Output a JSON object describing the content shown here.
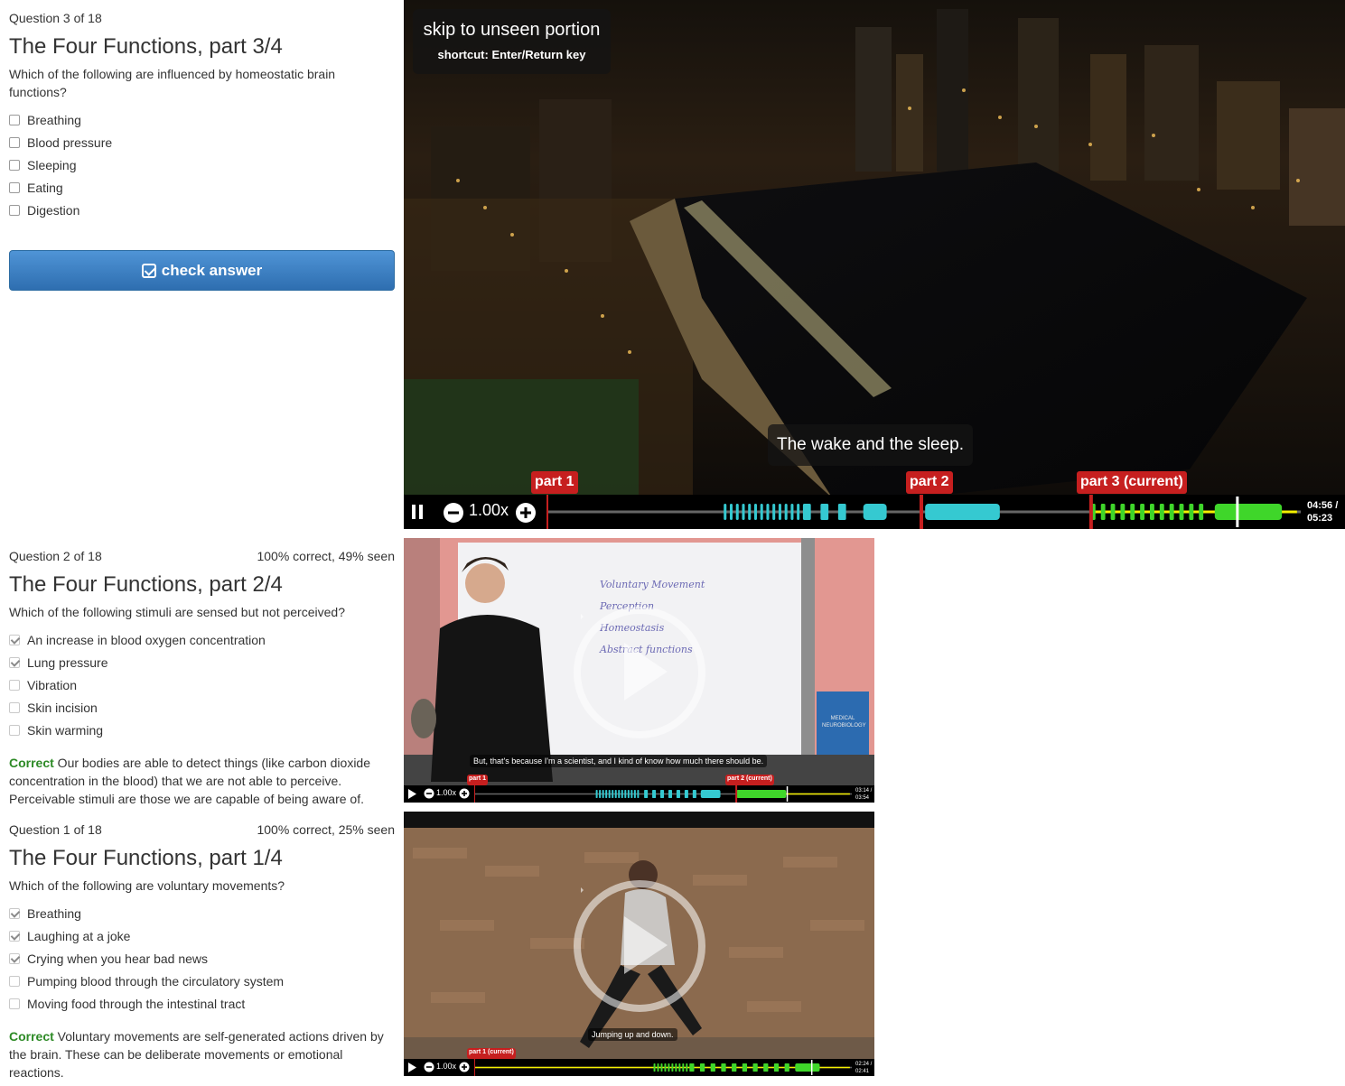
{
  "q3": {
    "meta": "Question 3 of 18",
    "title": "The Four Functions, part 3/4",
    "prompt": "Which of the following are influenced by homeostatic brain functions?",
    "options": [
      "Breathing",
      "Blood pressure",
      "Sleeping",
      "Eating",
      "Digestion"
    ],
    "checked": [
      false,
      false,
      false,
      false,
      false
    ],
    "button": "check answer"
  },
  "q2": {
    "meta": "Question 2 of 18",
    "score": "100% correct, 49% seen",
    "title": "The Four Functions, part 2/4",
    "prompt": "Which of the following stimuli are sensed but not perceived?",
    "options": [
      "An increase in blood oxygen concentration",
      "Lung pressure",
      "Vibration",
      "Skin incision",
      "Skin warming"
    ],
    "checked": [
      true,
      true,
      false,
      false,
      false
    ],
    "feedback_label": "Correct",
    "feedback_text": " Our bodies are able to detect things (like carbon dioxide concentration in the blood) that we are not able to perceive. Perceivable stimuli are those we are capable of being aware of."
  },
  "q1": {
    "meta": "Question 1 of 18",
    "score": "100% correct, 25% seen",
    "title": "The Four Functions, part 1/4",
    "prompt": "Which of the following are voluntary movements?",
    "options": [
      "Breathing",
      "Laughing at a joke",
      "Crying when you hear bad news",
      "Pumping blood through the circulatory system",
      "Moving food through the intestinal tract"
    ],
    "checked": [
      true,
      true,
      true,
      false,
      false
    ],
    "feedback_label": "Correct",
    "feedback_text": " Voluntary movements are self-generated actions driven by the brain. These can be deliberate movements or emotional reactions."
  },
  "video1": {
    "skip_title": "skip to unseen portion",
    "skip_shortcut": "shortcut: Enter/Return key",
    "subtitle": "The wake and the sleep.",
    "speed": "1.00x",
    "time_current": "04:56 /",
    "time_total": "05:23",
    "progress": 0.916,
    "markers": [
      "part 1",
      "part 2",
      "part 3 (current)"
    ]
  },
  "video2": {
    "subtitle": "But, that's because I'm a scientist, and I kind of know how much there should be.",
    "speed": "1.00x",
    "time_current": "03:14 /",
    "time_total": "03:54",
    "progress": 0.829,
    "markers": [
      "part 1",
      "part 2 (current)"
    ],
    "whiteboard": [
      "Voluntary Movement",
      "Perception",
      "Homeostasis",
      "Abstract functions"
    ],
    "book": "MEDICAL NEUROBIOLOGY"
  },
  "video3": {
    "subtitle": "Jumping up and down.",
    "speed": "1.00x",
    "time_current": "02:24 /",
    "time_total": "02:41",
    "progress": 0.894,
    "markers": [
      "part 1 (current)"
    ]
  },
  "colors": {
    "marker": "#c61f1f",
    "seen_cyan": "#35c9d1",
    "seen_green": "#3fd62a",
    "playhead_yellow": "#f4f000",
    "correct_green": "#2d8a26",
    "button_blue": "#337ab7"
  }
}
